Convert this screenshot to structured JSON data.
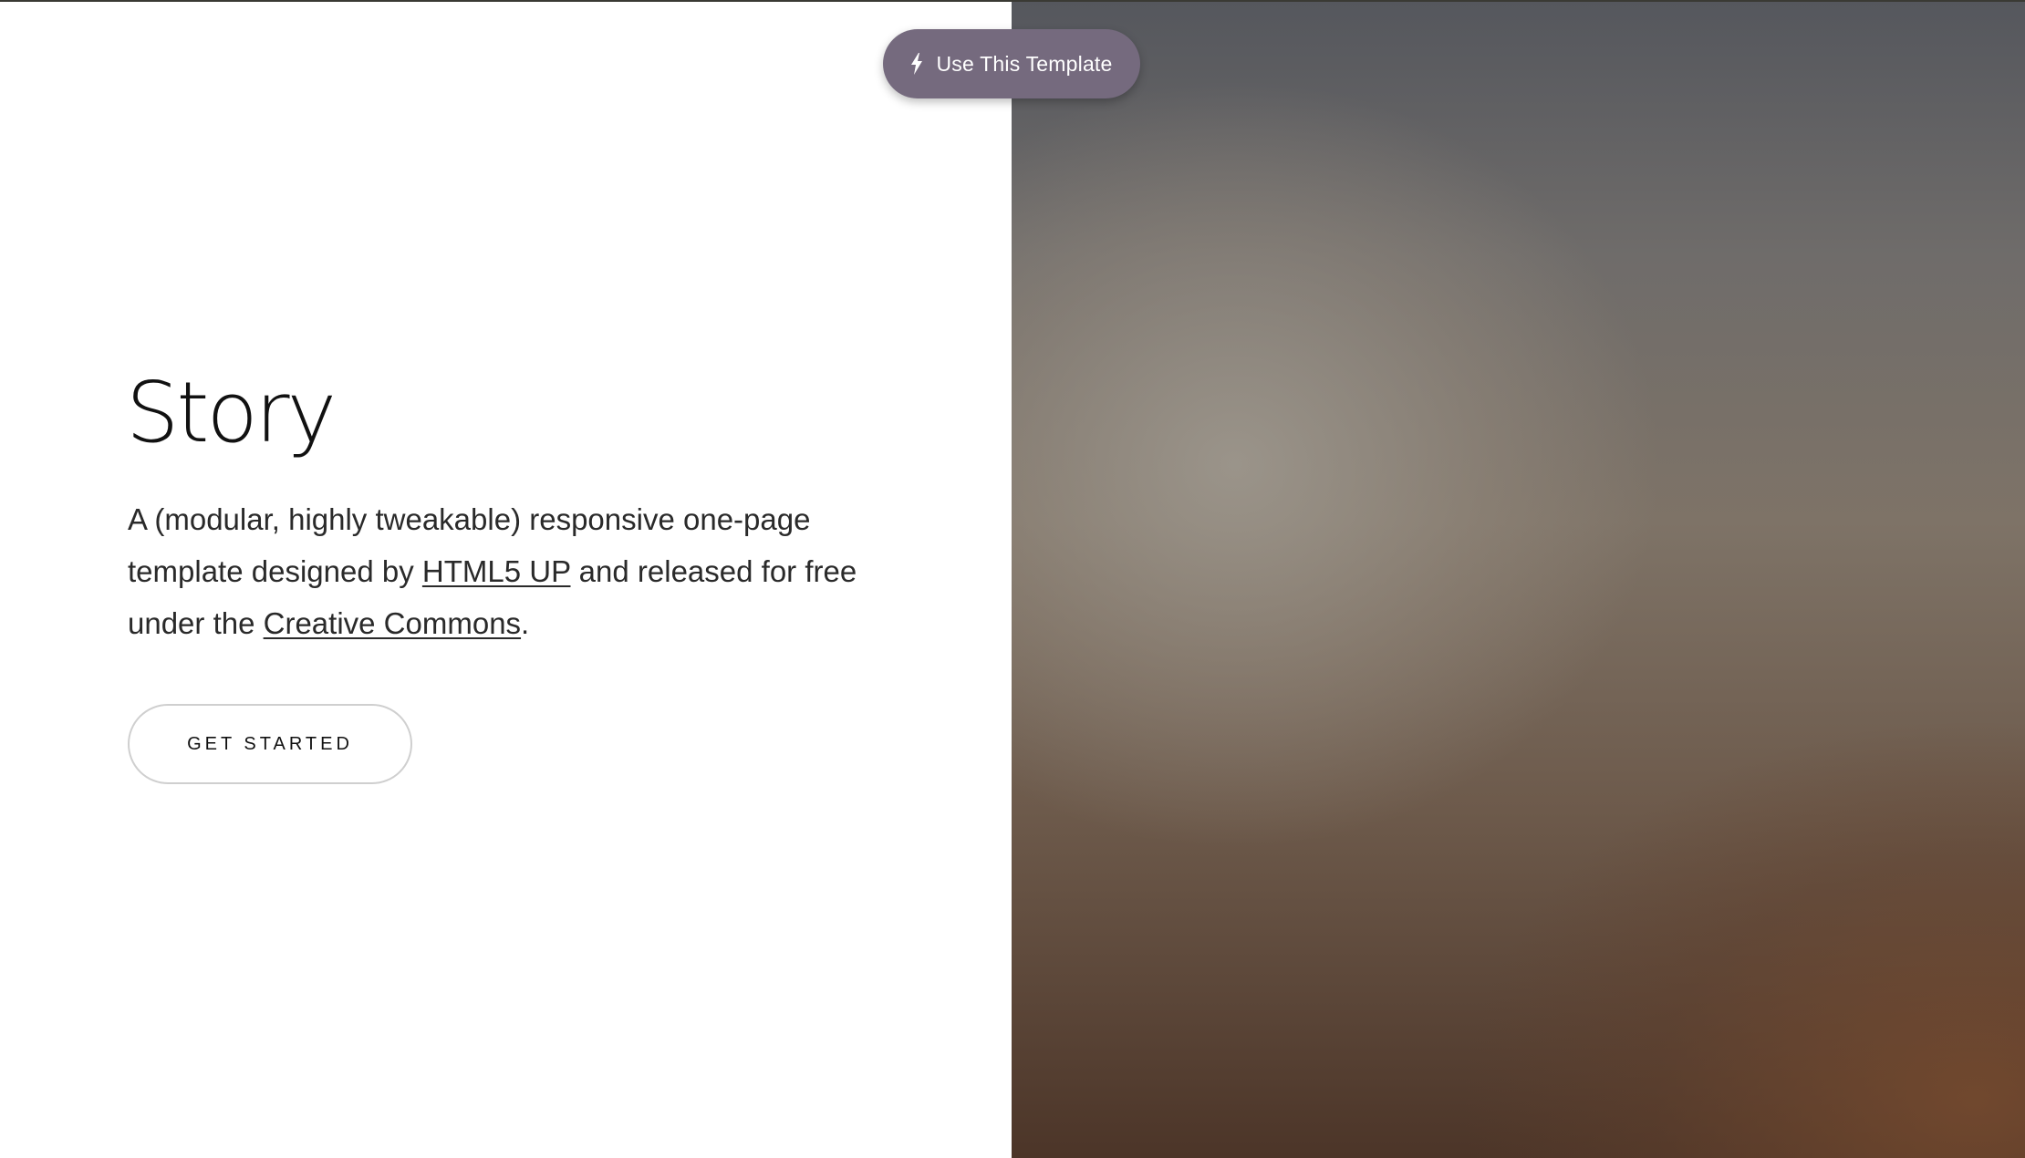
{
  "badge": {
    "label": "Use This Template",
    "icon": "bolt-icon"
  },
  "hero": {
    "title": "Story",
    "description_part1": "A (modular, highly tweakable) responsive one-page template designed by ",
    "link1": "HTML5 UP",
    "description_part2": " and released for free under the ",
    "link2": "Creative Commons",
    "description_part3": ".",
    "cta_label": "GET STARTED"
  },
  "colors": {
    "badge_background": "#756a7e",
    "image_tone_top": "#55575d",
    "image_tone_bottom": "#4c3528",
    "text": "#111111"
  }
}
